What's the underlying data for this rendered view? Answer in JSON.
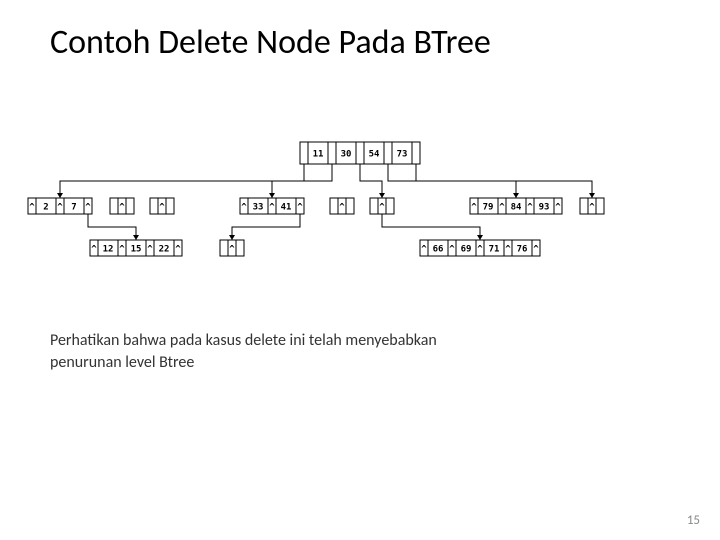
{
  "title": "Contoh Delete Node Pada BTree",
  "note_line1": "Perhatikan bahwa pada kasus delete ini telah menyebabkan",
  "note_line2": "penurunan level Btree",
  "page_number": "15",
  "tree": {
    "root": {
      "cells": [
        "",
        "11",
        "",
        "30",
        "",
        "54",
        "",
        "73",
        ""
      ]
    },
    "mid": [
      {
        "cells": [
          "^",
          "2",
          "^",
          "7",
          "^"
        ]
      },
      {
        "cells": [
          "",
          "^",
          ""
        ]
      },
      {
        "cells": [
          "",
          "^",
          ""
        ]
      },
      {
        "cells": [
          "^",
          "33",
          "^",
          "41",
          "^"
        ]
      },
      {
        "cells": [
          "",
          "^",
          ""
        ]
      },
      {
        "cells": [
          "",
          "^",
          ""
        ]
      },
      {
        "cells": [
          "^",
          "79",
          "^",
          "84",
          "^",
          "93",
          "^"
        ]
      },
      {
        "cells": [
          "",
          "^",
          ""
        ]
      }
    ],
    "bottom": [
      {
        "cells": [
          "^",
          "12",
          "^",
          "15",
          "^",
          "22",
          "^"
        ]
      },
      {
        "cells": [
          "",
          "^",
          ""
        ]
      },
      {
        "cells": [
          "^",
          "66",
          "^",
          "69",
          "^",
          "71",
          "^",
          "76",
          "^"
        ]
      }
    ]
  }
}
